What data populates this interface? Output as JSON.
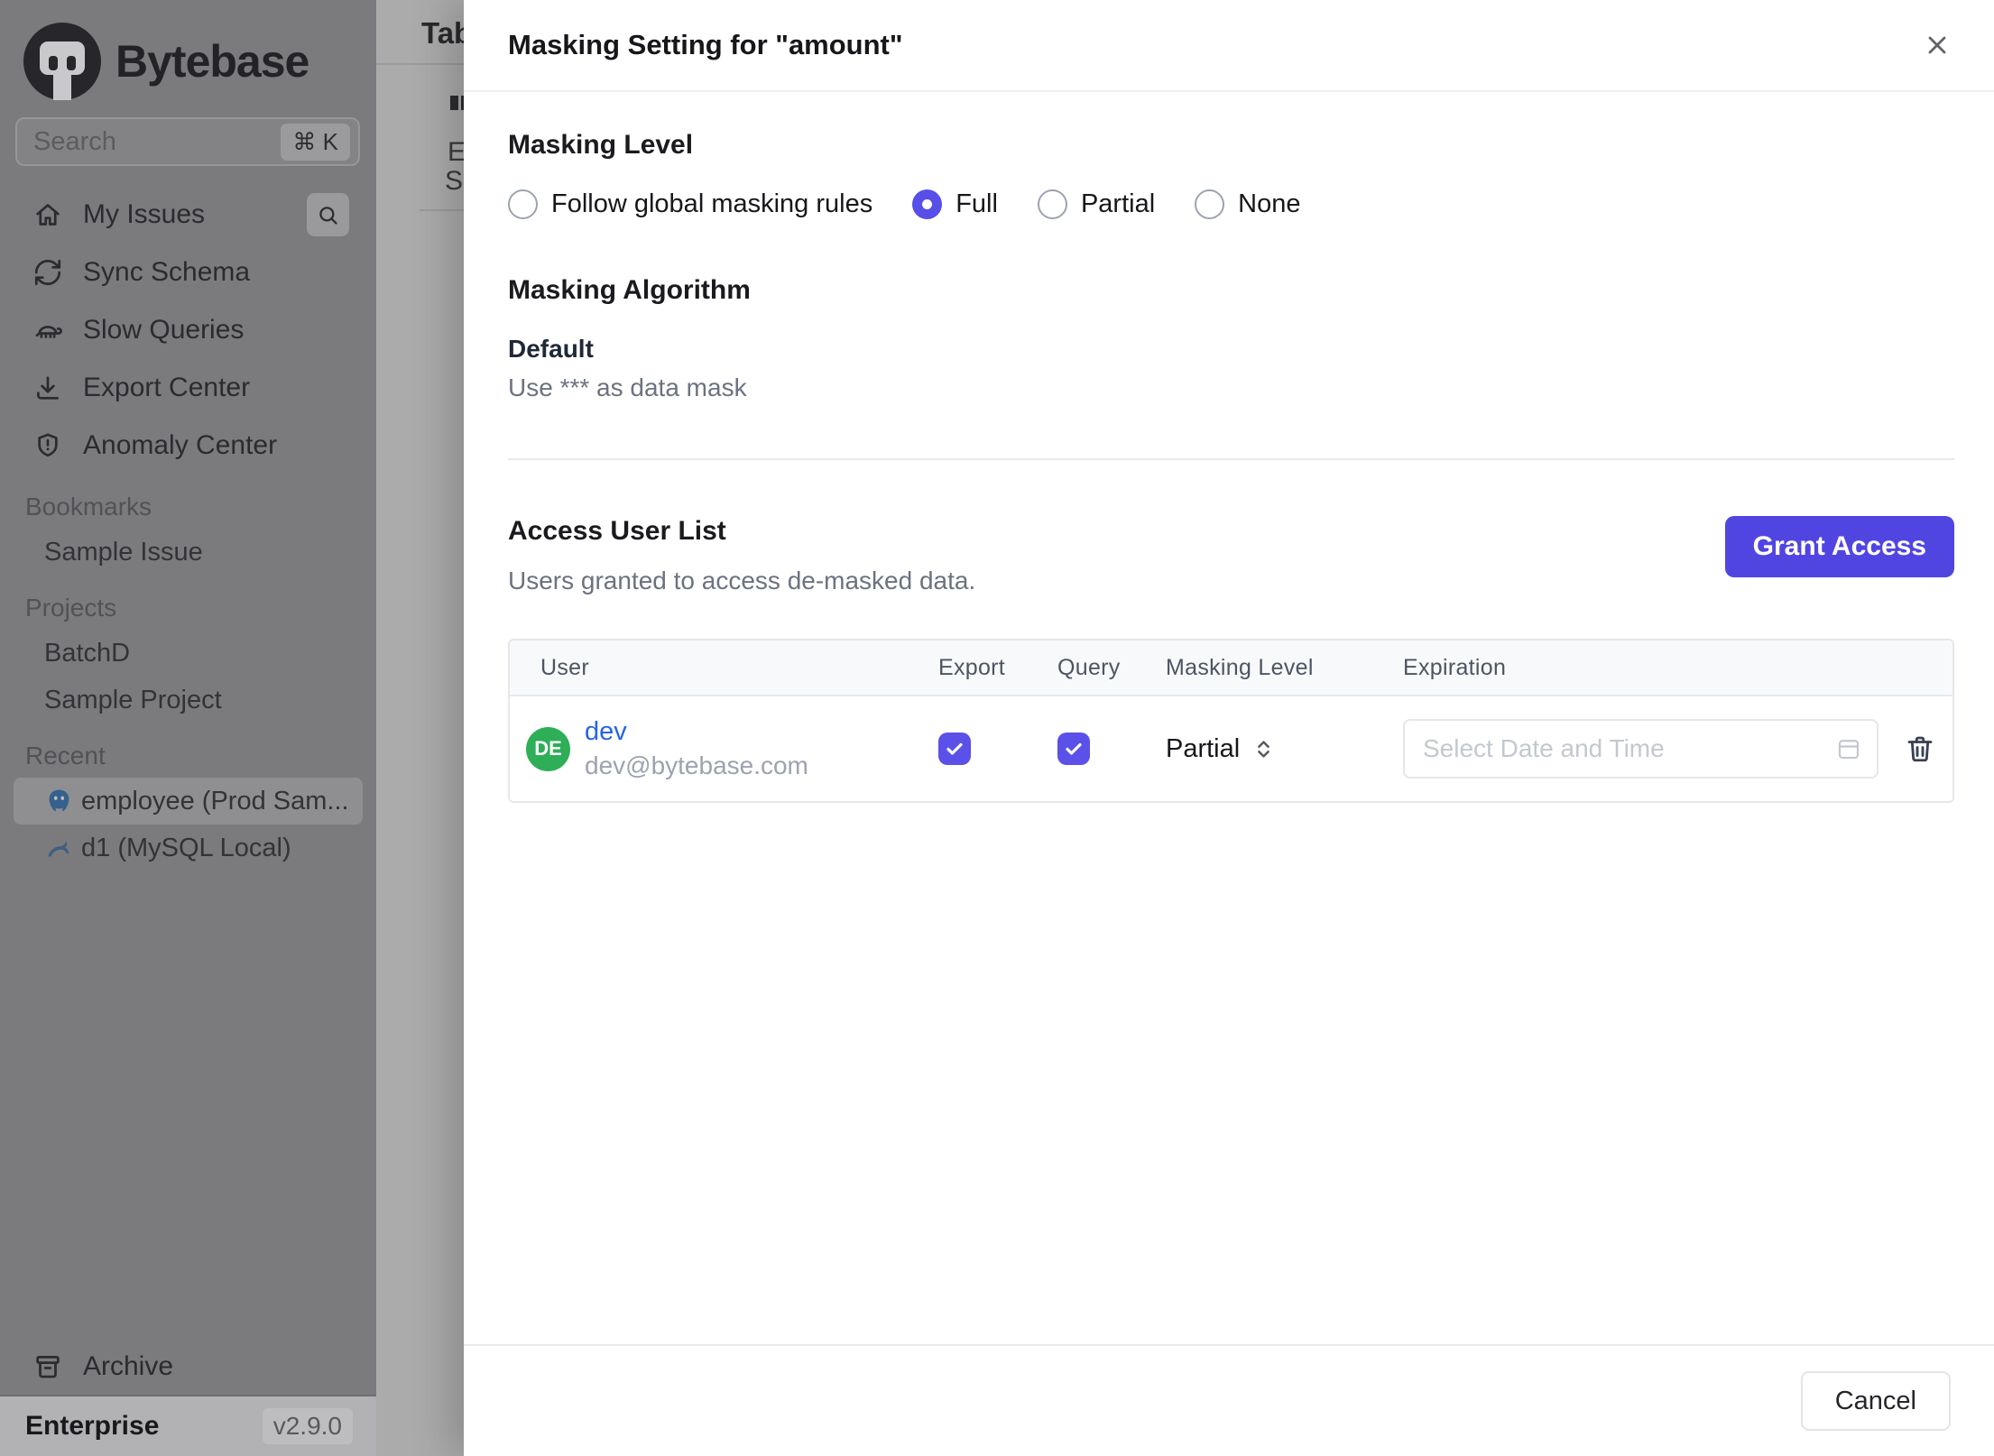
{
  "sidebar": {
    "logo_text": "Bytebase",
    "search": {
      "placeholder": "Search",
      "shortcut": "⌘ K"
    },
    "nav": [
      {
        "label": "My Issues",
        "icon": "home-icon"
      },
      {
        "label": "Sync Schema",
        "icon": "sync-icon"
      },
      {
        "label": "Slow Queries",
        "icon": "turtle-icon"
      },
      {
        "label": "Export Center",
        "icon": "download-icon"
      },
      {
        "label": "Anomaly Center",
        "icon": "shield-icon"
      }
    ],
    "sections": [
      {
        "title": "Bookmarks",
        "items": [
          {
            "label": "Sample Issue"
          }
        ]
      },
      {
        "title": "Projects",
        "items": [
          {
            "label": "BatchD"
          },
          {
            "label": "Sample Project"
          }
        ]
      },
      {
        "title": "Recent",
        "items": [
          {
            "label": "employee (Prod Sam...",
            "icon": "postgresql-icon",
            "active": true
          },
          {
            "label": "d1 (MySQL Local)",
            "icon": "mysql-icon",
            "active": false
          }
        ]
      }
    ],
    "archive_label": "Archive",
    "footer": {
      "plan": "Enterprise",
      "version": "v2.9.0"
    }
  },
  "background_page": {
    "tab_label": "Tab",
    "truncated_lines": [
      "E",
      "S"
    ]
  },
  "modal": {
    "title": "Masking Setting for \"amount\"",
    "masking_level": {
      "heading": "Masking Level",
      "options": [
        {
          "label": "Follow global masking rules",
          "selected": false
        },
        {
          "label": "Full",
          "selected": true
        },
        {
          "label": "Partial",
          "selected": false
        },
        {
          "label": "None",
          "selected": false
        }
      ]
    },
    "masking_algorithm": {
      "heading": "Masking Algorithm",
      "name": "Default",
      "description": "Use *** as data mask"
    },
    "access_user_list": {
      "heading": "Access User List",
      "subtitle": "Users granted to access de-masked data.",
      "grant_button_label": "Grant Access",
      "columns": [
        "User",
        "Export",
        "Query",
        "Masking Level",
        "Expiration"
      ],
      "rows": [
        {
          "avatar_initials": "DE",
          "name": "dev",
          "email": "dev@bytebase.com",
          "export_checked": true,
          "query_checked": true,
          "masking_level_value": "Partial",
          "expiration_placeholder": "Select Date and Time"
        }
      ]
    },
    "footer": {
      "cancel_label": "Cancel"
    }
  },
  "colors": {
    "accent_indigo": "#5145E2",
    "checkbox_indigo": "#5B50E8",
    "radio_indigo": "#584EE8",
    "avatar_green": "#2FAE58",
    "link_blue": "#2563EB",
    "overlay_dim": "rgba(0,0,0,0.33)"
  },
  "icons": [
    "bytebase-logo",
    "search-icon",
    "command-shortcut-badge",
    "home-icon",
    "sync-icon",
    "turtle-icon",
    "download-icon",
    "shield-icon",
    "postgresql-icon",
    "mysql-icon",
    "archive-icon",
    "close-icon",
    "checkbox-check-icon",
    "select-chevrons-icon",
    "calendar-icon",
    "trash-icon"
  ]
}
